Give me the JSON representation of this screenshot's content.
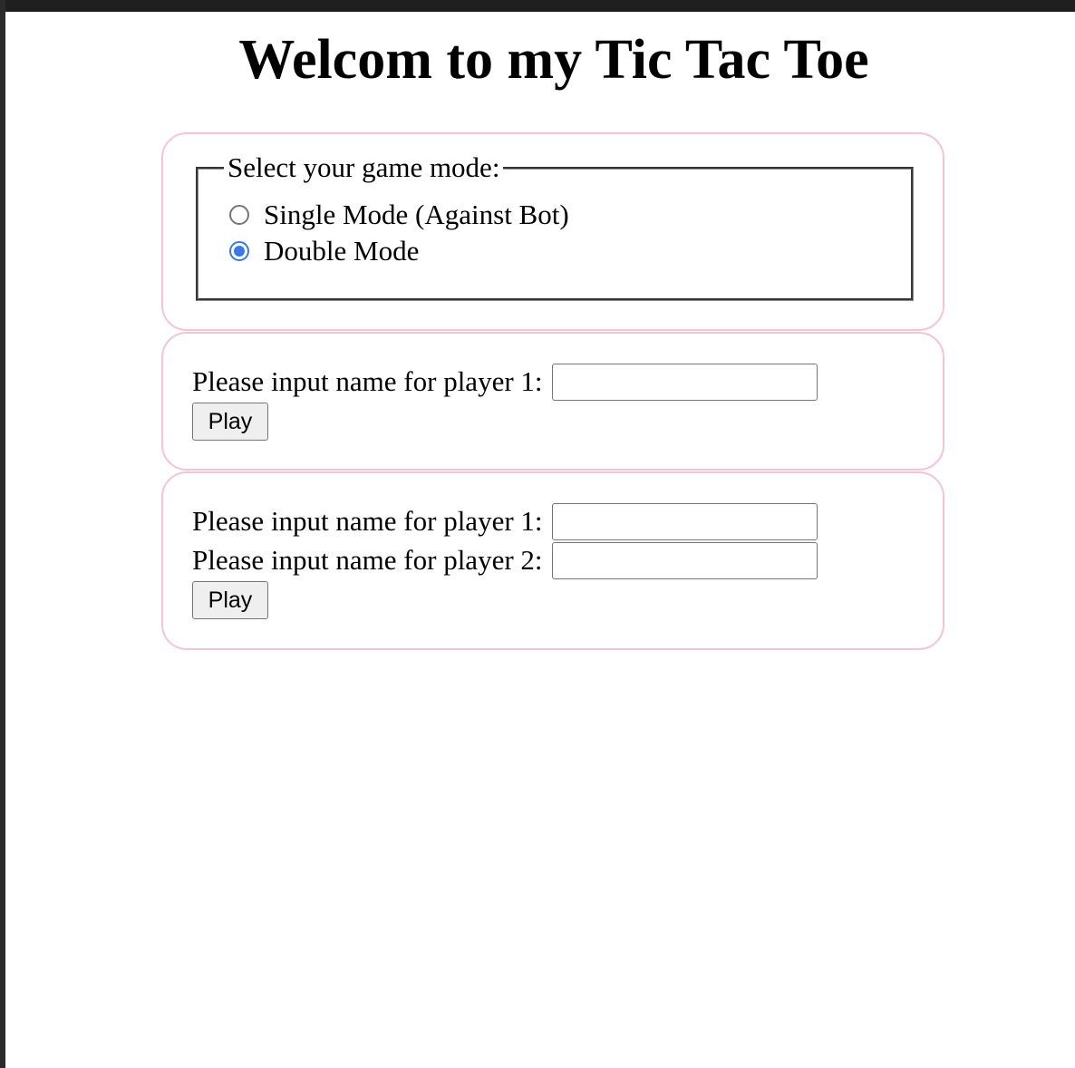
{
  "page": {
    "title": "Welcom to my Tic Tac Toe"
  },
  "game_mode": {
    "legend": "Select your game mode:",
    "options": [
      {
        "label": "Single Mode (Against Bot)",
        "checked": false
      },
      {
        "label": "Double Mode",
        "checked": true
      }
    ]
  },
  "single_mode": {
    "player1_label": "Please input name for player 1:",
    "player1_value": "",
    "play_label": "Play"
  },
  "double_mode": {
    "player1_label": "Please input name for player 1:",
    "player1_value": "",
    "player2_label": "Please input name for player 2:",
    "player2_value": "",
    "play_label": "Play"
  },
  "colors": {
    "panel_border": "#f3c5d2",
    "radio_accent": "#3b78e7",
    "window_chrome": "#1f1f1f"
  }
}
